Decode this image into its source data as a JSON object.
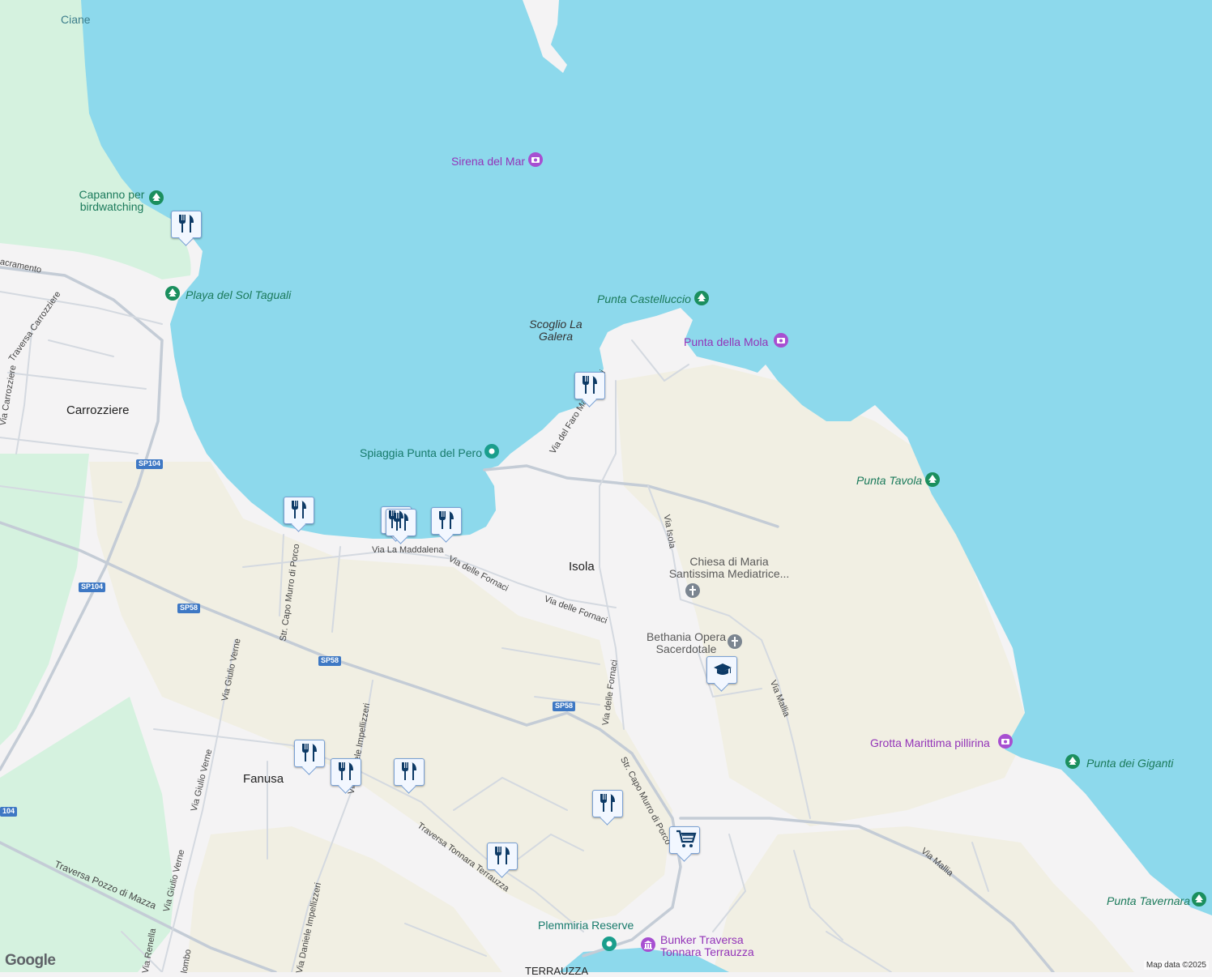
{
  "map": {
    "places": {
      "carrozziere": "Carrozziere",
      "isola": "Isola",
      "fanusa": "Fanusa",
      "terrauzza": "TERRAUZZA",
      "scoglio": "Scoglio La Galera"
    },
    "water": {
      "ciane": "Ciane"
    },
    "parks": {
      "capanno": "Capanno per birdwatching",
      "playa": "Playa del Sol Taguali",
      "punta_castelluccio": "Punta Castelluccio",
      "punta_tavola": "Punta Tavola",
      "punta_giganti": "Punta dei Giganti",
      "punta_tavernara": "Punta Tavernara"
    },
    "attractions": {
      "sirena": "Sirena del Mar",
      "punta_mola": "Punta della Mola",
      "grotta": "Grotta Marittima pillirina",
      "bunker": "Bunker Traversa Tonnara Terrauzza"
    },
    "teal_pois": {
      "spiaggia": "Spiaggia Punta del Pero",
      "plemmiria": "Plemmiria Reserve"
    },
    "churches": {
      "chiesa": "Chiesa di Maria Santissima Mediatrice...",
      "bethania": "Bethania Opera Sacerdotale"
    },
    "streets": {
      "sacramento": "acramento",
      "traversa_carrozziere": "Traversa Carrozziere",
      "via_carrozziere": "Via Carrozziere",
      "via_faro": "Via del Faro Massolivieri",
      "via_maddalena": "Via La Maddalena",
      "via_fornaci_1": "Via delle Fornaci",
      "via_fornaci_2": "Via delle Fornaci",
      "via_fornaci_3": "Via delle Fornaci",
      "via_isola": "Via Isola",
      "via_mallia_1": "Via Mallia",
      "via_mallia_2": "Via Mallia",
      "capo_murro_1": "Str. Capo Murro di Porco",
      "capo_murro_2": "Str. Capo Murro di Porco",
      "giulio_verne_1": "Via Giulio Verne",
      "giulio_verne_2": "Via Giulio Verne",
      "giulio_verne_3": "Via Giulio Verne",
      "impellizzeri_1": "Via Daniele Impellizzeri",
      "impellizzeri_2": "Via Daniele Impellizzeri",
      "tonnara": "Traversa Tonnara Terrauzza",
      "pozzo": "Traversa Pozzo di Mazza",
      "renella": "Via Renella",
      "colombo": "lombo"
    },
    "shields": {
      "sp104_a": "SP104",
      "sp104_b": "SP104",
      "sp104_c": "104",
      "sp58_a": "SP58",
      "sp58_b": "SP58",
      "sp58_c": "SP58"
    }
  },
  "footer": {
    "logo": "Google",
    "attribution": "Map data ©2025"
  },
  "colors": {
    "water": "#8dd9ec",
    "land": "#f4f3f4",
    "park": "#d4f1df",
    "scrub": "#efeee0",
    "road_major": "#c6cdd6",
    "marker_icon": "#0d3a66"
  }
}
